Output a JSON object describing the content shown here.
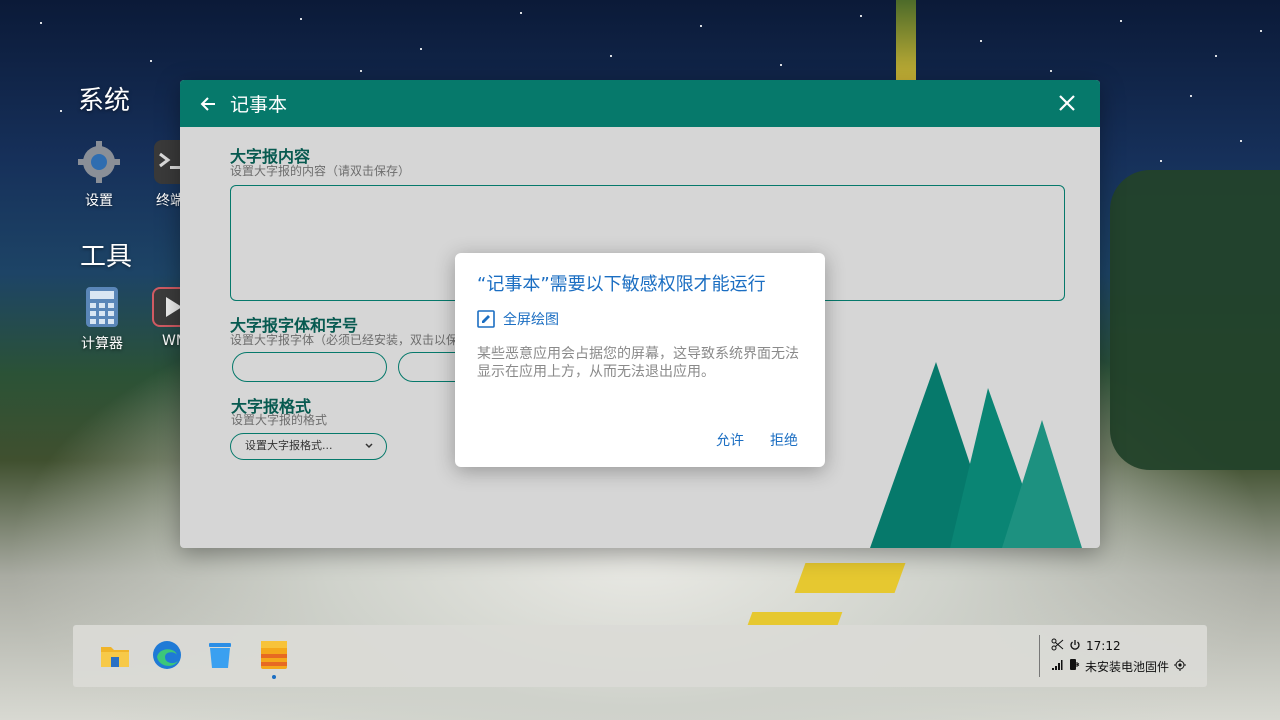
{
  "desktop": {
    "sections": [
      {
        "title": "系统"
      },
      {
        "title": "工具"
      }
    ],
    "icons": [
      {
        "label": "设置",
        "icon": "gear-icon"
      },
      {
        "label": "终端",
        "icon": "terminal-icon"
      },
      {
        "label": "计算器",
        "icon": "calculator-icon"
      },
      {
        "label": "WM",
        "icon": "video-player-icon"
      }
    ]
  },
  "window": {
    "title": "记事本",
    "fields": {
      "content_label": "大字报内容",
      "content_desc": "设置大字报的内容（请双击保存）",
      "font_label": "大字报字体和字号",
      "font_desc": "设置大字报字体（必须已经安装，双击以保",
      "format_label": "大字报格式",
      "format_desc": "设置大字报的格式",
      "format_select": "设置大字报格式..."
    },
    "accent": "#06796b"
  },
  "dialog": {
    "title": "“记事本”需要以下敏感权限才能运行",
    "permission": "全屏绘图",
    "description": "某些恶意应用会占据您的屏幕，这导致系统界面无法显示在应用上方，从而无法退出应用。",
    "allow": "允许",
    "deny": "拒绝",
    "accent": "#1b6ec2"
  },
  "taskbar": {
    "apps": [
      {
        "icon": "file-explorer-icon"
      },
      {
        "icon": "edge-browser-icon"
      },
      {
        "icon": "recycle-bin-icon"
      },
      {
        "icon": "notepad-app-icon",
        "active": true
      }
    ],
    "tray": {
      "time": "17:12",
      "battery_text": "未安装电池固件"
    }
  }
}
